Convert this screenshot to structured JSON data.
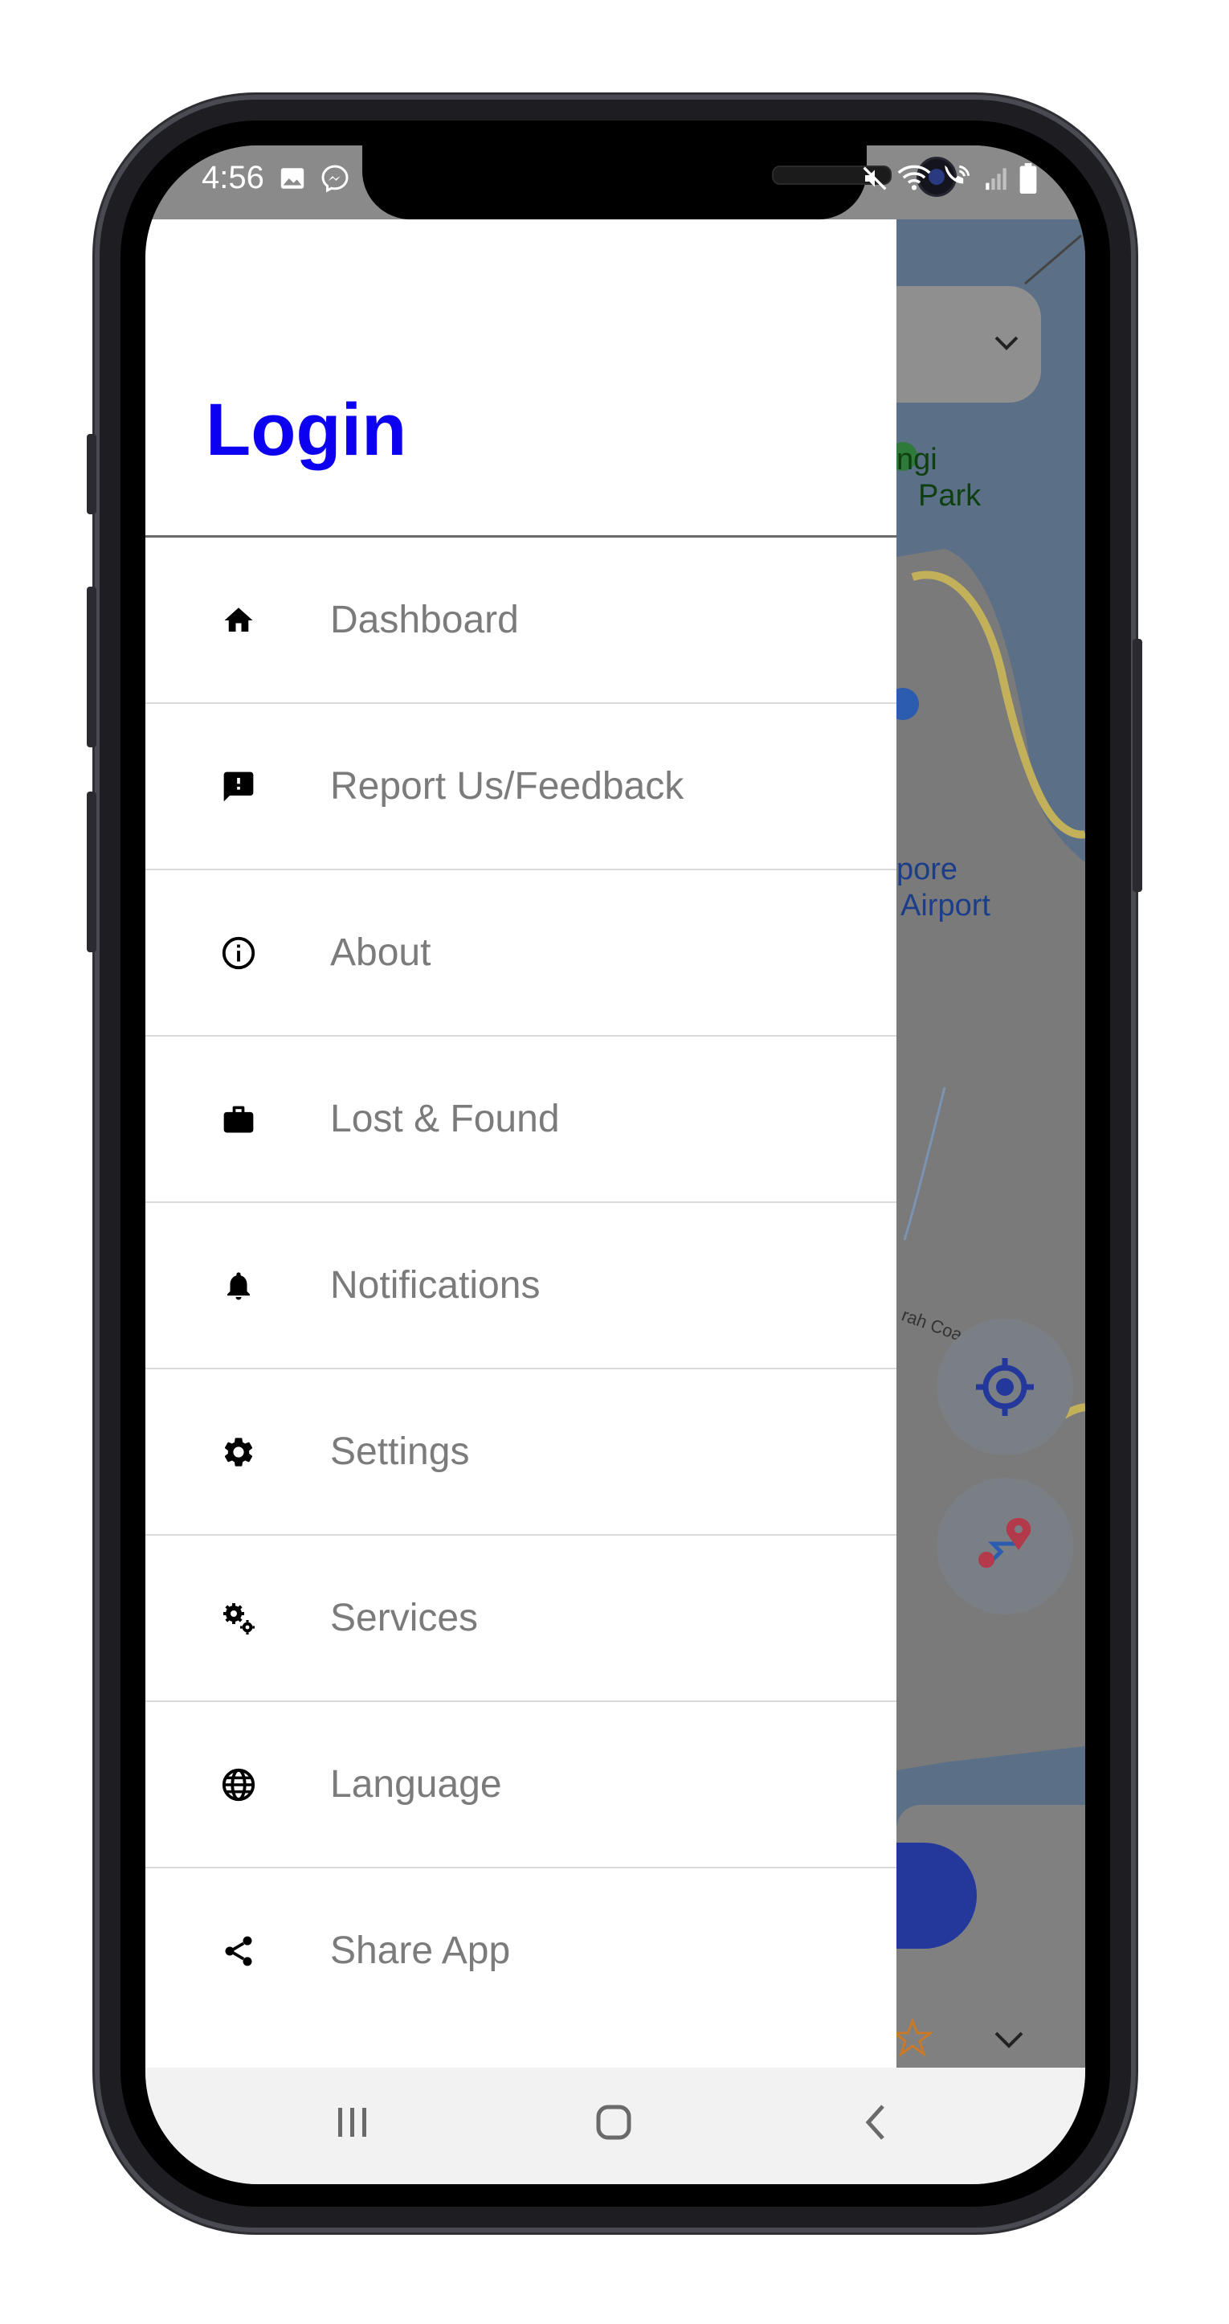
{
  "status_bar": {
    "time": "4:56"
  },
  "map": {
    "labels": [
      "ngi",
      "Park",
      "pore",
      "Airport",
      "rah Coa"
    ]
  },
  "drawer": {
    "title": "Login",
    "items": [
      {
        "label": "Dashboard",
        "icon": "home-icon"
      },
      {
        "label": "Report Us/Feedback",
        "icon": "feedback-icon"
      },
      {
        "label": "About",
        "icon": "info-icon"
      },
      {
        "label": "Lost & Found",
        "icon": "briefcase-icon"
      },
      {
        "label": "Notifications",
        "icon": "bell-icon"
      },
      {
        "label": "Settings",
        "icon": "gear-icon"
      },
      {
        "label": "Services",
        "icon": "gears-icon"
      },
      {
        "label": "Language",
        "icon": "globe-icon"
      },
      {
        "label": "Share App",
        "icon": "share-icon"
      }
    ]
  },
  "colors": {
    "title": "#0d00f0",
    "menu_text": "#7b7b7b",
    "map_water": "#5b6f86"
  }
}
